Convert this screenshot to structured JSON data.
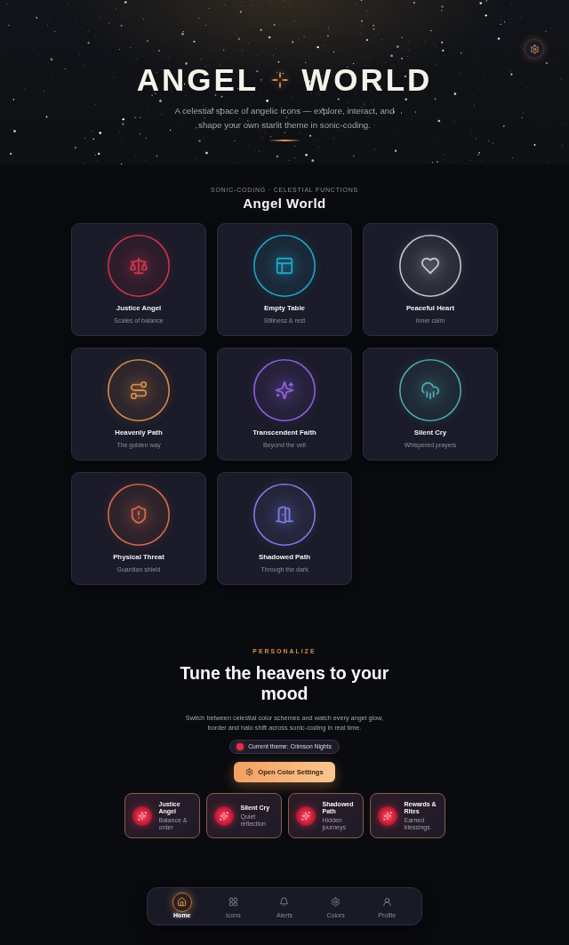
{
  "hero": {
    "title_words": [
      "ANGEL",
      "WORLD"
    ],
    "subtitle": "A celestial space of angelic icons — explore, interact, and shape your own starlit theme in sonic-coding."
  },
  "gallery": {
    "eyebrow": "SONIC-CODING · CELESTIAL FUNCTIONS",
    "title": "Angel World",
    "cards": [
      {
        "name": "Justice Angel",
        "description": "Scales of balance",
        "color": "#c8364a"
      },
      {
        "name": "Empty Table",
        "description": "Stillness & rest",
        "color": "#1ea6c8"
      },
      {
        "name": "Peaceful Heart",
        "description": "Inner calm",
        "color": "#c4c4ce"
      },
      {
        "name": "Heavenly Path",
        "description": "The golden way",
        "color": "#cf8a4c"
      },
      {
        "name": "Transcendent Faith",
        "description": "Beyond the veil",
        "color": "#8d5fdc"
      },
      {
        "name": "Silent Cry",
        "description": "Whispered prayers",
        "color": "#4aa8aa"
      },
      {
        "name": "Physical Threat",
        "description": "Guardian shield",
        "color": "#d46a4c"
      },
      {
        "name": "Shadowed Path",
        "description": "Through the dark",
        "color": "#7c7ce0"
      }
    ]
  },
  "personalize": {
    "eyebrow": "PERSONALIZE",
    "title": "Tune the heavens to your mood",
    "text": "Switch between celestial color schemes and watch every angel glow, border and halo shift across sonic-coding in real time.",
    "current_theme": "Current theme: Crimson Nights",
    "button": "Open Color Settings",
    "highlights": [
      {
        "name": "Justice Angel",
        "description": "Balance & order"
      },
      {
        "name": "Silent Cry",
        "description": "Quiet reflection"
      },
      {
        "name": "Shadowed Path",
        "description": "Hidden journeys"
      },
      {
        "name": "Rewards & Rites",
        "description": "Earned blessings"
      }
    ]
  },
  "bottom_nav": [
    {
      "label": "Home",
      "selected": true
    },
    {
      "label": "Icons",
      "selected": false
    },
    {
      "label": "Alerts",
      "selected": false
    },
    {
      "label": "Colors",
      "selected": false
    },
    {
      "label": "Profile",
      "selected": false
    }
  ]
}
